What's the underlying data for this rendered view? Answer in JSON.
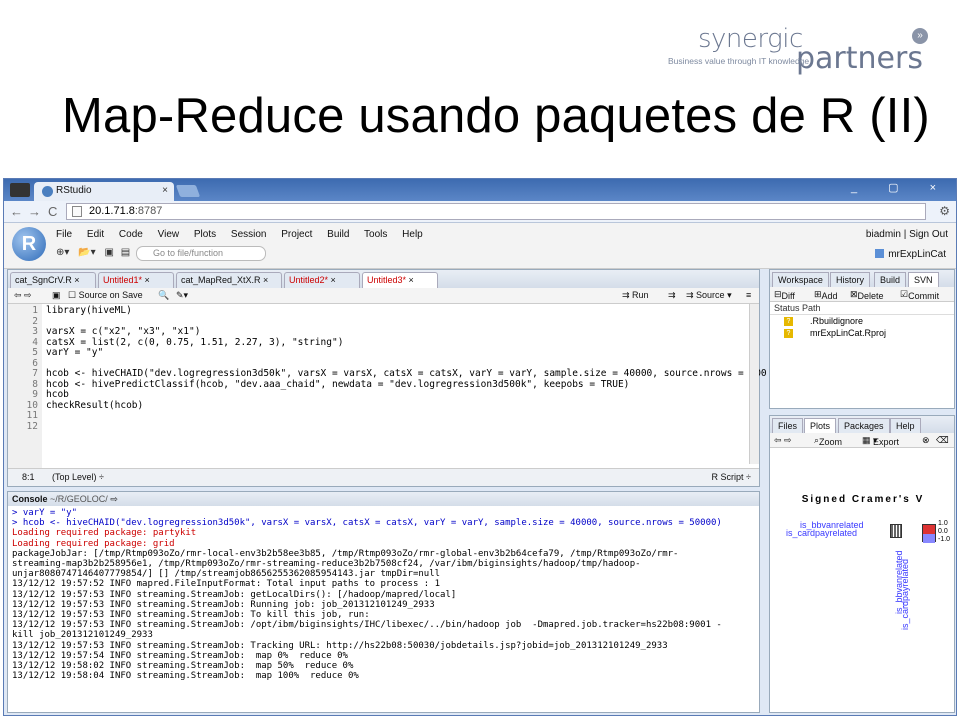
{
  "logo": {
    "word1": "synergic",
    "word2": "partners",
    "tagline": "Business value through IT knowledge",
    "circle_glyph": "»"
  },
  "title": "Map-Reduce usando paquetes de R (II)",
  "browser": {
    "tab_title": "RStudio",
    "tab_close": "×",
    "window_controls": "_ ▢ ×",
    "url_host": "20.1.71.8",
    "url_port": ":8787",
    "nav": {
      "back": "←",
      "forward": "→",
      "reload": "C",
      "star": "☆",
      "wrench": "⚙"
    }
  },
  "rstudio": {
    "logo_letter": "R",
    "menu": [
      "File",
      "Edit",
      "Code",
      "View",
      "Plots",
      "Session",
      "Project",
      "Build",
      "Tools",
      "Help"
    ],
    "user": "biadmin | Sign Out",
    "goto_placeholder": "Go to file/function",
    "project": "mrExpLinCat"
  },
  "editor": {
    "tabs": [
      {
        "name": "cat_SgnCrV.R",
        "modified": false
      },
      {
        "name": "Untitled1*",
        "modified": true
      },
      {
        "name": "cat_MapRed_XtX.R",
        "modified": false
      },
      {
        "name": "Untitled2*",
        "modified": true
      },
      {
        "name": "Untitled3*",
        "modified": true
      }
    ],
    "source_on_save": "Source on Save",
    "run": "Run",
    "source": "Source",
    "line_numbers": [
      "1",
      "2",
      "3",
      "4",
      "5",
      "6",
      "7",
      "8",
      "9",
      "10",
      "11",
      "12"
    ],
    "code_lines": [
      "library(hiveML)",
      "",
      "varsX = c(\"x2\", \"x3\", \"x1\")",
      "catsX = list(2, c(0, 0.75, 1.51, 2.27, 3), \"string\")",
      "varY = \"y\"",
      "",
      "hcob <- hiveCHAID(\"dev.logregression3d50k\", varsX = varsX, catsX = catsX, varY = varY, sample.size = 40000, source.nrows = 500",
      "hcob <- hivePredictClassif(hcob, \"dev.aaa_chaid\", newdata = \"dev.logregression3d500k\", keepobs = TRUE)",
      "hcob",
      "checkResult(hcob)",
      "",
      ""
    ],
    "status_pos": "8:1",
    "status_scope": "(Top Level) ÷",
    "status_type": "R Script ÷"
  },
  "console": {
    "title": "Console",
    "path": "~/R/GEOLOC/",
    "lines": [
      {
        "cls": "cmd",
        "text": "> varY = \"y\""
      },
      {
        "cls": "cmd",
        "text": "> hcob <- hiveCHAID(\"dev.logregression3d50k\", varsX = varsX, catsX = catsX, varY = varY, sample.size = 40000, source.nrows = 50000)"
      },
      {
        "cls": "red",
        "text": "Loading required package: partykit"
      },
      {
        "cls": "red",
        "text": "Loading required package: grid"
      },
      {
        "cls": "",
        "text": "packageJobJar: [/tmp/Rtmp093oZo/rmr-local-env3b2b58ee3b85, /tmp/Rtmp093oZo/rmr-global-env3b2b64cefa79, /tmp/Rtmp093oZo/rmr-"
      },
      {
        "cls": "",
        "text": "streaming-map3b2b258956e1, /tmp/Rtmp093oZo/rmr-streaming-reduce3b2b7508cf24, /var/ibm/biginsights/hadoop/tmp/hadoop-"
      },
      {
        "cls": "",
        "text": "unjar8080747146407779854/] [] /tmp/streamjob8656255362085954143.jar tmpDir=null"
      },
      {
        "cls": "",
        "text": "13/12/12 19:57:52 INFO mapred.FileInputFormat: Total input paths to process : 1"
      },
      {
        "cls": "",
        "text": "13/12/12 19:57:53 INFO streaming.StreamJob: getLocalDirs(): [/hadoop/mapred/local]"
      },
      {
        "cls": "",
        "text": "13/12/12 19:57:53 INFO streaming.StreamJob: Running job: job_201312101249_2933"
      },
      {
        "cls": "",
        "text": "13/12/12 19:57:53 INFO streaming.StreamJob: To kill this job, run:"
      },
      {
        "cls": "",
        "text": "13/12/12 19:57:53 INFO streaming.StreamJob: /opt/ibm/biginsights/IHC/libexec/../bin/hadoop job  -Dmapred.job.tracker=hs22b08:9001 -"
      },
      {
        "cls": "",
        "text": "kill job_201312101249_2933"
      },
      {
        "cls": "",
        "text": "13/12/12 19:57:53 INFO streaming.StreamJob: Tracking URL: http://hs22b08:50030/jobdetails.jsp?jobid=job_201312101249_2933"
      },
      {
        "cls": "",
        "text": "13/12/12 19:57:54 INFO streaming.StreamJob:  map 0%  reduce 0%"
      },
      {
        "cls": "",
        "text": "13/12/12 19:58:02 INFO streaming.StreamJob:  map 50%  reduce 0%"
      },
      {
        "cls": "",
        "text": "13/12/12 19:58:04 INFO streaming.StreamJob:  map 100%  reduce 0%"
      }
    ]
  },
  "vcs_pane": {
    "tabs": [
      "Workspace",
      "History",
      "Build",
      "SVN"
    ],
    "tools": [
      "Diff",
      "Add",
      "Delete",
      "Commit"
    ],
    "header": "Status  Path",
    "files": [
      ".Rbuildignore",
      "mrExpLinCat.Rproj"
    ],
    "status_glyph": "?"
  },
  "plots_pane": {
    "tabs": [
      "Files",
      "Plots",
      "Packages",
      "Help"
    ],
    "zoom": "Zoom",
    "export": "Export",
    "plot_title": "Signed Cramer's V",
    "labels_h": [
      "is_bbvanrelated",
      "is_cardpayrelated"
    ],
    "labels_v": [
      "is_bbvanrelated",
      "is_cardpayrelated"
    ],
    "legend_ticks": [
      "1.0",
      "0.0",
      "-1.0"
    ]
  }
}
